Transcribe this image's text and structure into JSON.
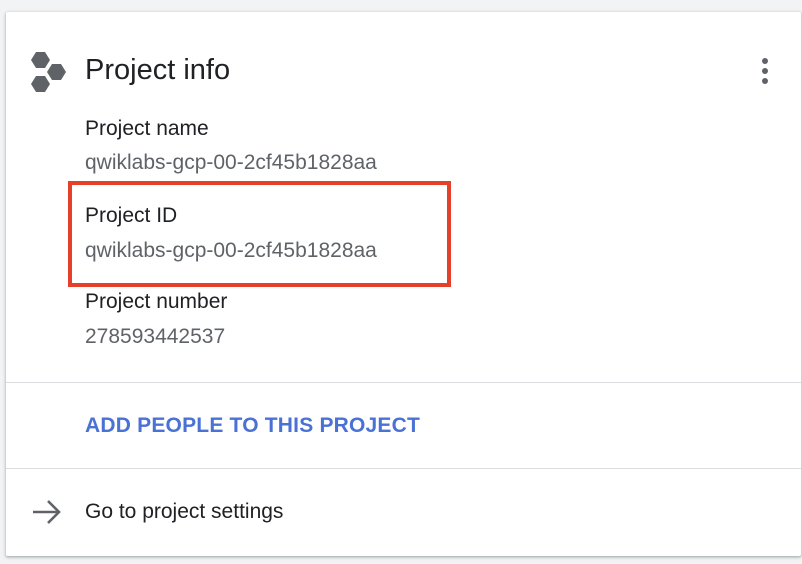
{
  "card": {
    "title": "Project info",
    "fields": [
      {
        "label": "Project name",
        "value": "qwiklabs-gcp-00-2cf45b1828aa"
      },
      {
        "label": "Project ID",
        "value": "qwiklabs-gcp-00-2cf45b1828aa"
      },
      {
        "label": "Project number",
        "value": "278593442537"
      }
    ],
    "add_people_label": "ADD PEOPLE TO THIS PROJECT",
    "settings_label": "Go to project settings"
  },
  "colors": {
    "highlight": "#e6402b",
    "link": "#4a72d4",
    "icon": "#5f6368"
  },
  "icons": {
    "project": "hexagon-cluster-icon",
    "more": "more-vert-icon",
    "settings": "arrow-right-icon"
  }
}
